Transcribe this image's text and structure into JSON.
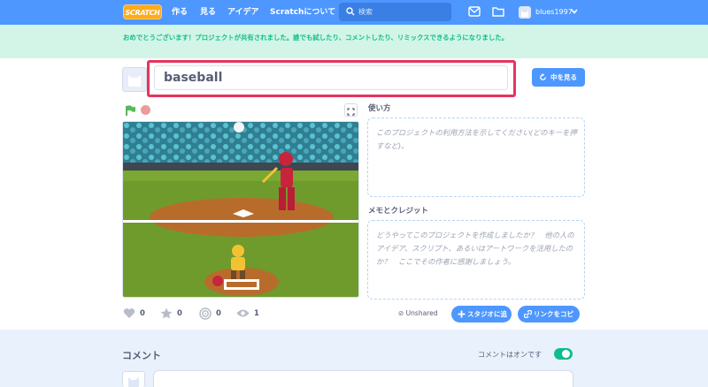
{
  "nav": {
    "logo": "SCRATCH",
    "links": [
      "作る",
      "見る",
      "アイデア",
      "Scratchについて"
    ],
    "search_placeholder": "検索",
    "username": "blues1997"
  },
  "banner": {
    "message": "おめでとうございます！プロジェクトが共有されました。誰でも試したり、コメントしたり、リミックスできるようになりました。"
  },
  "project": {
    "title": "baseball",
    "see_inside_label": "中を見る"
  },
  "instructions": {
    "label": "使い方",
    "placeholder": "このプロジェクトの利用方法を示してください(どのキーを押すなど)。"
  },
  "notes": {
    "label": "メモとクレジット",
    "placeholder": "どうやってこのプロジェクトを作成しましたか？　他の人のアイデア、スクリプト、あるいはアートワークを活用したのか？　ここでその作者に感謝しましょう。"
  },
  "stats": {
    "loves": "0",
    "favorites": "0",
    "remixes": "0",
    "views": "1"
  },
  "share": {
    "status": "Unshared",
    "add_to_studio": "スタジオに追加",
    "copy_link": "リンクをコピー"
  },
  "comments": {
    "title": "コメント",
    "status": "コメントはオンです",
    "enabled": true
  },
  "colors": {
    "nav": "#4d97ff",
    "banner_bg": "#d2f5e7",
    "banner_text": "#0fbd8c",
    "highlight": "#e6335d",
    "toggle_on": "#0fbd8c"
  },
  "icons": [
    "search-icon",
    "envelope-icon",
    "folder-icon",
    "chevron-down-icon",
    "green-flag-icon",
    "stop-icon",
    "fullscreen-icon",
    "heart-icon",
    "star-icon",
    "remix-icon",
    "eye-icon",
    "plus-icon",
    "link-icon",
    "rotate-icon"
  ]
}
